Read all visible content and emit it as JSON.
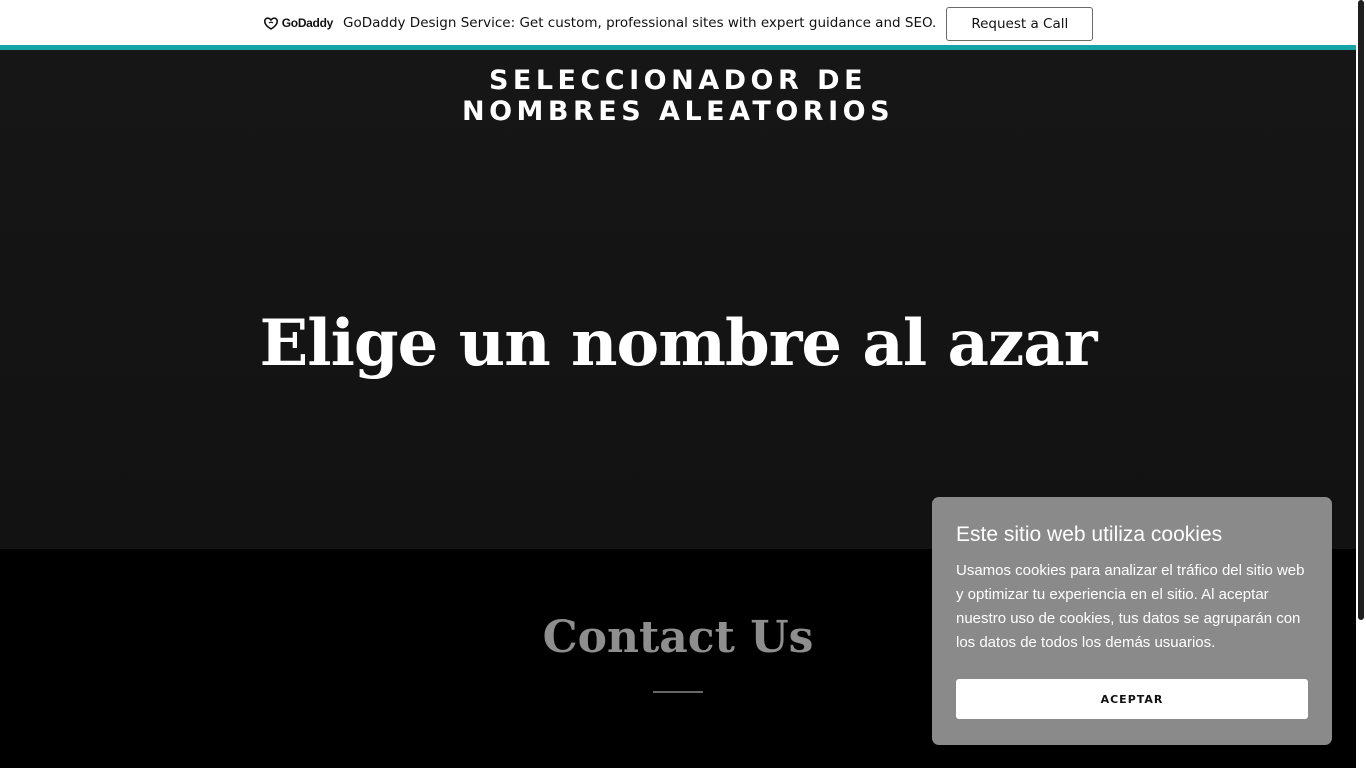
{
  "promo": {
    "logo_text": "GoDaddy",
    "logo_icon": "godaddy-logo-icon",
    "text": "GoDaddy Design Service: Get custom, professional sites with expert guidance and SEO.",
    "button_label": "Request a Call"
  },
  "header": {
    "site_title_line1": "SELECCIONADOR DE",
    "site_title_line2": "NOMBRES ALEATORIOS"
  },
  "hero": {
    "heading": "Elige un nombre al azar"
  },
  "contact": {
    "title": "Contact Us"
  },
  "cookie": {
    "title": "Este sitio web utiliza cookies",
    "body": "Usamos cookies para analizar el tráfico del sitio web y optimizar tu experiencia en el sitio. Al aceptar nuestro uso de cookies, tus datos se agruparán con los datos de todos los demás usuarios.",
    "accept_label": "ACEPTAR"
  },
  "colors": {
    "accent": "#16a3a5",
    "hero_bg": "#141414",
    "cookie_bg": "#8a8a8a"
  }
}
